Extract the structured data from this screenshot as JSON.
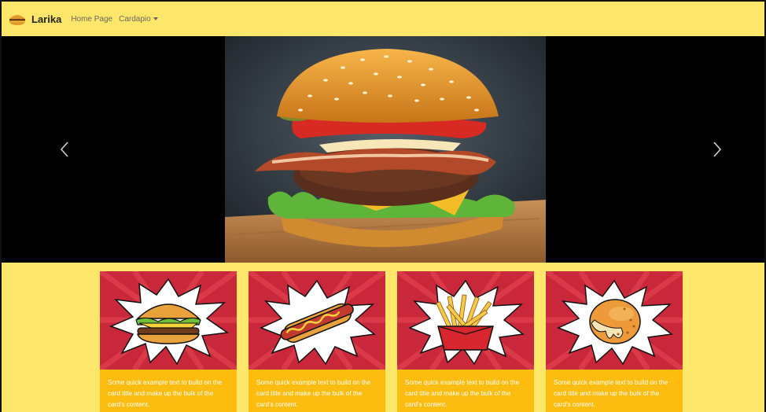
{
  "navbar": {
    "brand": "Larika",
    "links": [
      {
        "label": "Home Page"
      },
      {
        "label": "Cardapio"
      }
    ]
  },
  "carousel": {
    "prev_icon": "chevron-left-icon",
    "next_icon": "chevron-right-icon"
  },
  "cards": [
    {
      "image": "burger-icon",
      "text": "Some quick example text to build on the card title and make up the bulk of the card's content."
    },
    {
      "image": "hotdog-icon",
      "text": "Some quick example text to build on the card title and make up the bulk of the card's content."
    },
    {
      "image": "fries-icon",
      "text": "Some quick example text to build on the card title and make up the bulk of the card's content."
    },
    {
      "image": "coxinha-icon",
      "text": "Some quick example text to build on the card title and make up the bulk of the card's content."
    }
  ],
  "colors": {
    "background": "#fde76a",
    "card_body": "#fcbd10",
    "card_image_bg": "#c8283a"
  }
}
